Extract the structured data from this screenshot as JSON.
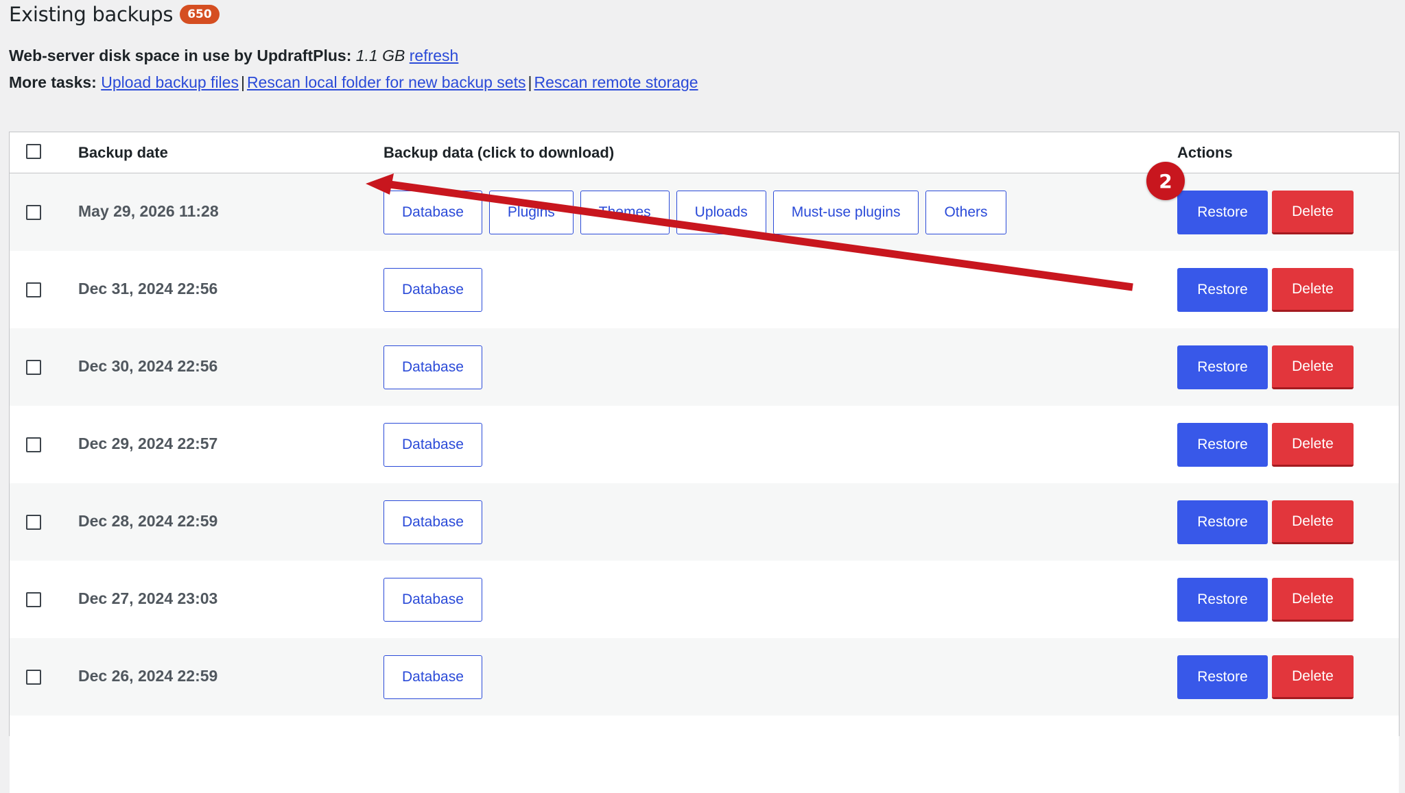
{
  "header": {
    "title": "Existing backups",
    "count_badge": "650"
  },
  "disk": {
    "label": "Web-server disk space in use by UpdraftPlus:",
    "value": "1.1 GB",
    "refresh_link": "refresh"
  },
  "tasks": {
    "label": "More tasks:",
    "links": [
      "Upload backup files",
      "Rescan local folder for new backup sets",
      "Rescan remote storage"
    ],
    "separator": "|"
  },
  "table": {
    "columns": {
      "date": "Backup date",
      "data": "Backup data (click to download)",
      "actions": "Actions"
    },
    "restore_label": "Restore",
    "delete_label": "Delete",
    "rows": [
      {
        "date": "May 29, 2026 11:28",
        "data": [
          "Database",
          "Plugins",
          "Themes",
          "Uploads",
          "Must-use plugins",
          "Others"
        ]
      },
      {
        "date": "Dec 31, 2024 22:56",
        "data": [
          "Database"
        ]
      },
      {
        "date": "Dec 30, 2024 22:56",
        "data": [
          "Database"
        ]
      },
      {
        "date": "Dec 29, 2024 22:57",
        "data": [
          "Database"
        ]
      },
      {
        "date": "Dec 28, 2024 22:59",
        "data": [
          "Database"
        ]
      },
      {
        "date": "Dec 27, 2024 23:03",
        "data": [
          "Database"
        ]
      },
      {
        "date": "Dec 26, 2024 22:59",
        "data": [
          "Database"
        ]
      },
      {
        "date": "",
        "data": []
      }
    ]
  },
  "annotation": {
    "step_number": "2",
    "color": "#c8161e"
  }
}
